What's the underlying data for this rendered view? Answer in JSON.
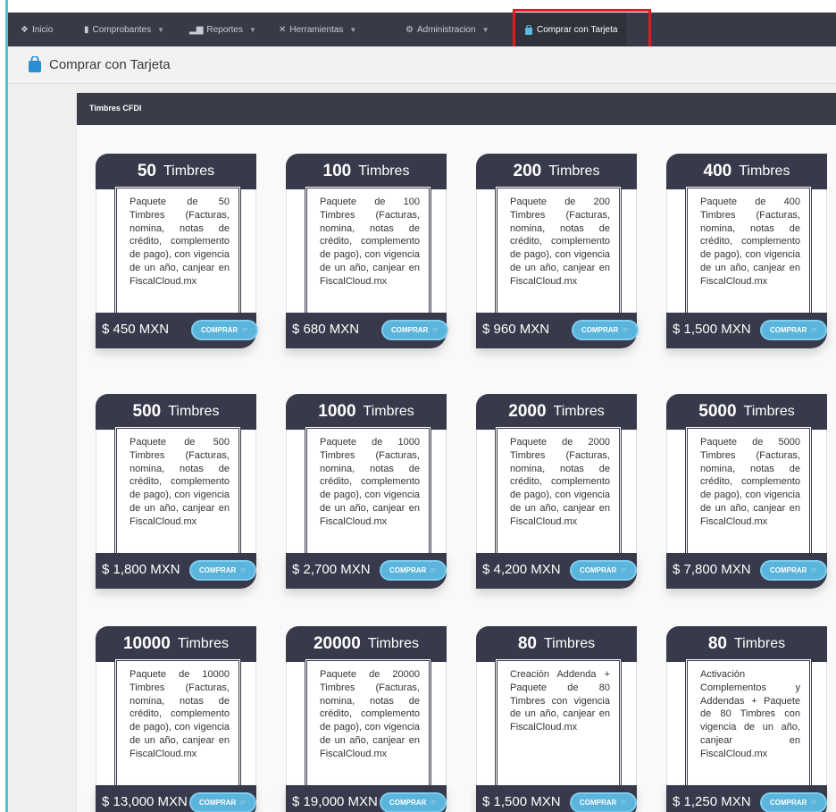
{
  "nav": {
    "items": [
      {
        "label": "Inicio",
        "icon": "home-icon"
      },
      {
        "label": "Comprobantes",
        "icon": "file-icon"
      },
      {
        "label": "Reportes",
        "icon": "bar-chart-icon"
      },
      {
        "label": "Herramientas",
        "icon": "tools-icon"
      },
      {
        "label": "Administracion",
        "icon": "cogs-icon"
      }
    ],
    "active": {
      "label": "Comprar con Tarjeta",
      "icon": "shopping-bag-icon"
    }
  },
  "page": {
    "title": "Comprar con Tarjeta"
  },
  "panel": {
    "title": "Timbres CFDI"
  },
  "buy_label": "COMPRAR",
  "cards": [
    {
      "qty": "50",
      "unit": "Timbres",
      "desc": "Paquete de 50 Timbres (Facturas, nomina, notas de crédito, complemento de pago), con vigencia de un año, canjear en FiscalCloud.mx",
      "price": "$ 450 MXN"
    },
    {
      "qty": "100",
      "unit": "Timbres",
      "desc": "Paquete de 100 Timbres (Facturas, nomina, notas de crédito, complemento de pago), con vigencia de un año, canjear en FiscalCloud.mx",
      "price": "$ 680 MXN"
    },
    {
      "qty": "200",
      "unit": "Timbres",
      "desc": "Paquete de 200 Timbres (Facturas, nomina, notas de crédito, complemento de pago), con vigencia de un año, canjear en FiscalCloud.mx",
      "price": "$ 960 MXN"
    },
    {
      "qty": "400",
      "unit": "Timbres",
      "desc": "Paquete de 400 Timbres (Facturas, nomina, notas de crédito, complemento de pago), con vigencia de un año, canjear en FiscalCloud.mx",
      "price": "$ 1,500 MXN"
    },
    {
      "qty": "500",
      "unit": "Timbres",
      "desc": "Paquete de 500 Timbres (Facturas, nomina, notas de crédito, complemento de pago), con vigencia de un año, canjear en FiscalCloud.mx",
      "price": "$ 1,800 MXN"
    },
    {
      "qty": "1000",
      "unit": "Timbres",
      "desc": "Paquete de 1000 Timbres (Facturas, nomina, notas de crédito, complemento de pago), con vigencia de un año, canjear en FiscalCloud.mx",
      "price": "$ 2,700 MXN"
    },
    {
      "qty": "2000",
      "unit": "Timbres",
      "desc": "Paquete de 2000 Timbres (Facturas, nomina, notas de crédito, complemento de pago), con vigencia de un año, canjear en FiscalCloud.mx",
      "price": "$ 4,200 MXN"
    },
    {
      "qty": "5000",
      "unit": "Timbres",
      "desc": "Paquete de 5000 Timbres (Facturas, nomina, notas de crédito, complemento de pago), con vigencia de un año, canjear en FiscalCloud.mx",
      "price": "$ 7,800 MXN"
    },
    {
      "qty": "10000",
      "unit": "Timbres",
      "desc": "Paquete de 10000 Timbres (Facturas, nomina, notas de crédito, complemento de pago), con vigencia de un año, canjear en FiscalCloud.mx",
      "price": "$ 13,000 MXN"
    },
    {
      "qty": "20000",
      "unit": "Timbres",
      "desc": "Paquete de 20000 Timbres (Facturas, nomina, notas de crédito, complemento de pago), con vigencia de un año, canjear en FiscalCloud.mx",
      "price": "$ 19,000 MXN"
    },
    {
      "qty": "80",
      "unit": "Timbres",
      "desc": "Creación Addenda + Paquete de 80 Timbres con vigencia de un año, canjear en FiscalCloud.mx",
      "price": "$ 1,500 MXN"
    },
    {
      "qty": "80",
      "unit": "Timbres",
      "desc": "Activación Complementos y Addendas + Paquete de 80 Timbres con vigencia de un año, canjear en FiscalCloud.mx",
      "price": "$ 1,250 MXN"
    }
  ]
}
